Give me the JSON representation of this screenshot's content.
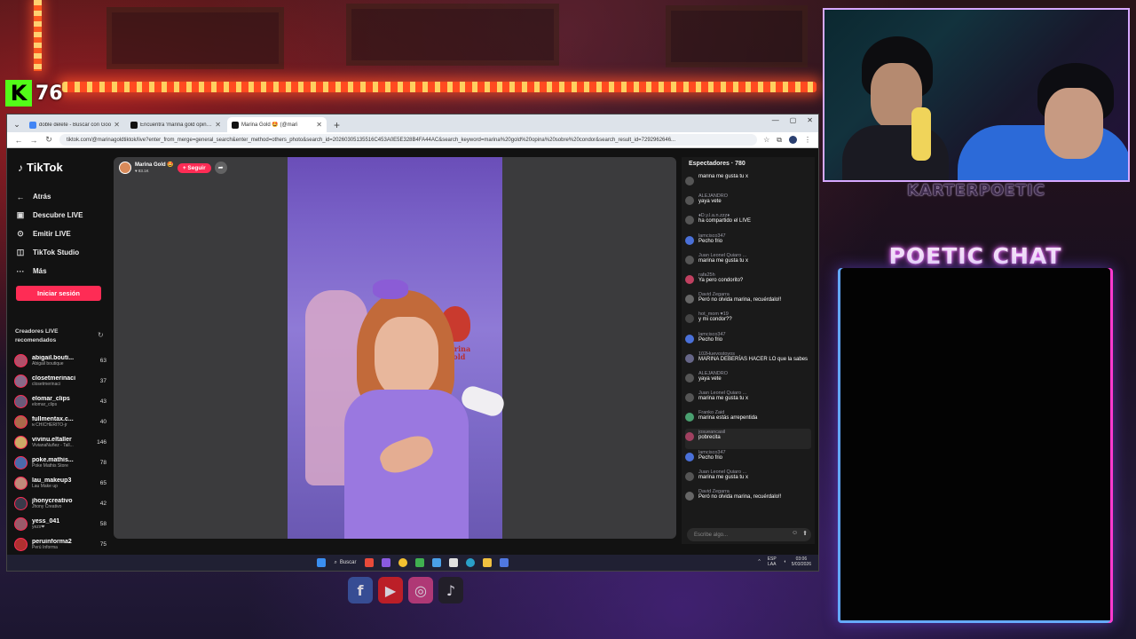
{
  "overlay": {
    "kick_viewers": "76",
    "streamer_name": "KARTERPOETIC",
    "chat_title": "POETIC CHAT"
  },
  "browser": {
    "tabs": [
      {
        "label": "doble delete - Buscar con Goo",
        "active": false,
        "color": "#4285f4"
      },
      {
        "label": "Encuentra 'marina gold opina s",
        "active": false,
        "color": "#111111"
      },
      {
        "label": "Marina Gold 🤩 (@mari",
        "active": true,
        "color": "#111111"
      }
    ],
    "url": "tiktok.com/@marinagoldtiktok/live?enter_from_merge=general_search&enter_method=others_photo&search_id=20260305135516C453A0E5E328B4FA44AC&search_keyword=marina%20gold%20opina%20sobre%20condor&search_result_id=7292962646..."
  },
  "tiktok": {
    "logo": "TikTok",
    "nav": [
      {
        "icon": "←",
        "label": "Atrás"
      },
      {
        "icon": "▣",
        "label": "Descubre LIVE"
      },
      {
        "icon": "⊙",
        "label": "Emitir LIVE"
      },
      {
        "icon": "◫",
        "label": "TikTok Studio"
      },
      {
        "icon": "···",
        "label": "Más"
      }
    ],
    "login_label": "Iniciar sesión",
    "recommended_title": "Creadores LIVE recomendados",
    "creators": [
      {
        "name": "abigail.bouti...",
        "sub": "Abigail boutique",
        "count": "63",
        "color": "#b0506a"
      },
      {
        "name": "closetmerinaci",
        "sub": "closetmerinaci",
        "count": "37",
        "color": "#8a6a8a"
      },
      {
        "name": "elomar_clips",
        "sub": "elomar_clips",
        "count": "43",
        "color": "#6a5a7a"
      },
      {
        "name": "fullmentax.c...",
        "sub": "ɴ CHICHERITO-jr",
        "count": "40",
        "color": "#aa6a4a"
      },
      {
        "name": "vivinu.eltaller",
        "sub": "VivianaNuñez - Tall...",
        "count": "146",
        "color": "#ccaa66"
      },
      {
        "name": "poke.mathis...",
        "sub": "Poke Mathis Store",
        "count": "78",
        "color": "#4a6aaa"
      },
      {
        "name": "lau_makeup3",
        "sub": "Lau Make up",
        "count": "65",
        "color": "#c08a7a"
      },
      {
        "name": "jhonycreativo",
        "sub": "Jhony Creativo",
        "count": "42",
        "color": "#3a3a4a"
      },
      {
        "name": "yess_041",
        "sub": "yezx❤",
        "count": "58",
        "color": "#9a5a6a"
      },
      {
        "name": "peruinforma2",
        "sub": "Perú Informa",
        "count": "75",
        "color": "#b03030"
      }
    ],
    "host": {
      "name": "Marina Gold 🤩",
      "likes": "♥ 83.1K",
      "follow": "+ Seguir",
      "share": "➦"
    },
    "video_poster_text": "Marina Gold",
    "chat_header": "Espectadores · 780",
    "chat": [
      {
        "user": "",
        "text": "marina me gusta tu x",
        "color": "#555555"
      },
      {
        "user": "ALEJANDRO",
        "text": "yaya vete",
        "color": "#555555"
      },
      {
        "user": "♦D.y.l.a.n.zzz♦",
        "text": "ha compartido el LIVE",
        "color": "#555555"
      },
      {
        "user": "lamcisco347",
        "text": "Pecho frio",
        "color": "#4a70d8"
      },
      {
        "user": "Juan Leonel Quiaro ...",
        "text": "marina me gusta tu x",
        "color": "#555555"
      },
      {
        "user": "rafa25h",
        "text": "Ya pero condorito?",
        "color": "#c04060"
      },
      {
        "user": "David Zegarra",
        "text": "Peró no olvida marina, recuérdalo!!",
        "color": "#666666"
      },
      {
        "user": "hot_mom ♥19",
        "text": "y mi condor??",
        "color": "#444444"
      },
      {
        "user": "lamcisco347",
        "text": "Pecho frio",
        "color": "#4a70d8"
      },
      {
        "user": "102Huevostoyos",
        "text": "MARINA DEBERÍAS HACER LO que la sabes",
        "color": "#666688"
      },
      {
        "user": "ALEJANDRO",
        "text": "yaya vete",
        "color": "#555555"
      },
      {
        "user": "Juan Leonel Quiaro ...",
        "text": "marina me gusta tu x",
        "color": "#555555"
      },
      {
        "user": "Franko Zaid",
        "text": "marina estás arrepentida",
        "color": "#4aa070"
      },
      {
        "user": "josueancasil",
        "text": "pobrecita",
        "color": "#a04060"
      },
      {
        "user": "lamcisco347",
        "text": "Pecho frio",
        "color": "#4a70d8"
      },
      {
        "user": "Juan Leonel Quiaro ...",
        "text": "marina me gusta tu x",
        "color": "#555555"
      },
      {
        "user": "David Zegarra",
        "text": "Peró no olvida marina, recuérdalo!!",
        "color": "#666666"
      }
    ],
    "chat_placeholder": "Escribe algo..."
  },
  "taskbar": {
    "search": "Buscar",
    "lang": "ESP LAA",
    "time": "03:06",
    "date": "5/03/2026"
  }
}
